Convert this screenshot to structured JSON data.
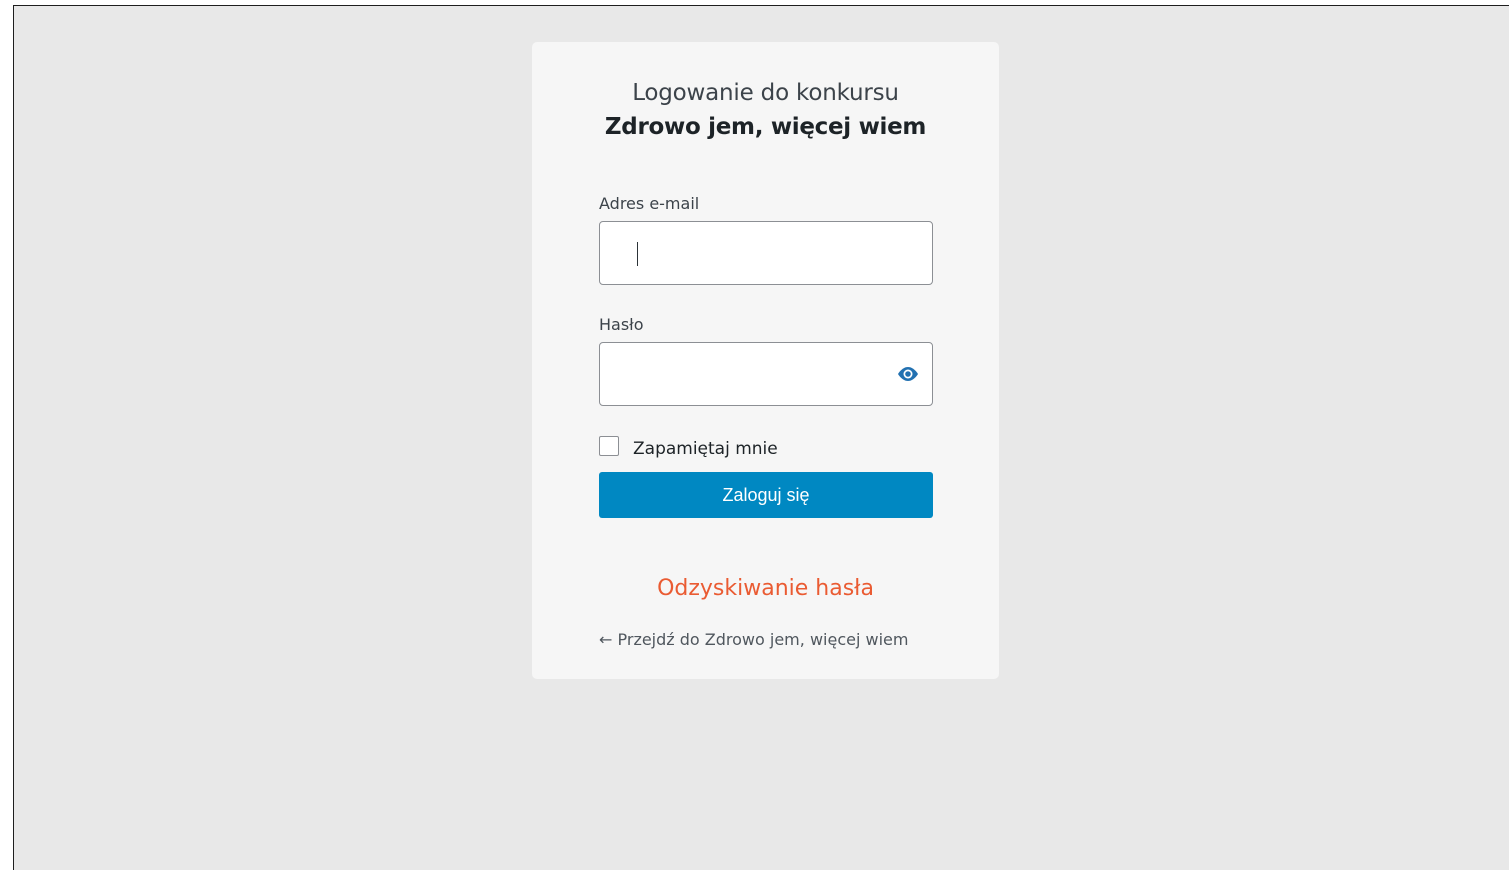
{
  "login": {
    "title_line1": "Logowanie do konkursu",
    "title_line2": "Zdrowo jem, więcej wiem",
    "email_label": "Adres e-mail",
    "email_value": "",
    "password_label": "Hasło",
    "password_value": "",
    "show_password_icon": "eye-icon",
    "remember_label": "Zapamiętaj mnie",
    "remember_checked": false,
    "submit_label": "Zaloguj się",
    "recover_link": "Odzyskiwanie hasła",
    "back_link": "← Przejdź do Zdrowo jem, więcej wiem"
  },
  "colors": {
    "background": "#e8e8e8",
    "card": "#f6f6f6",
    "primary_button": "#0088c2",
    "recover_link": "#ea5b32",
    "eye_icon": "#2271b1"
  }
}
